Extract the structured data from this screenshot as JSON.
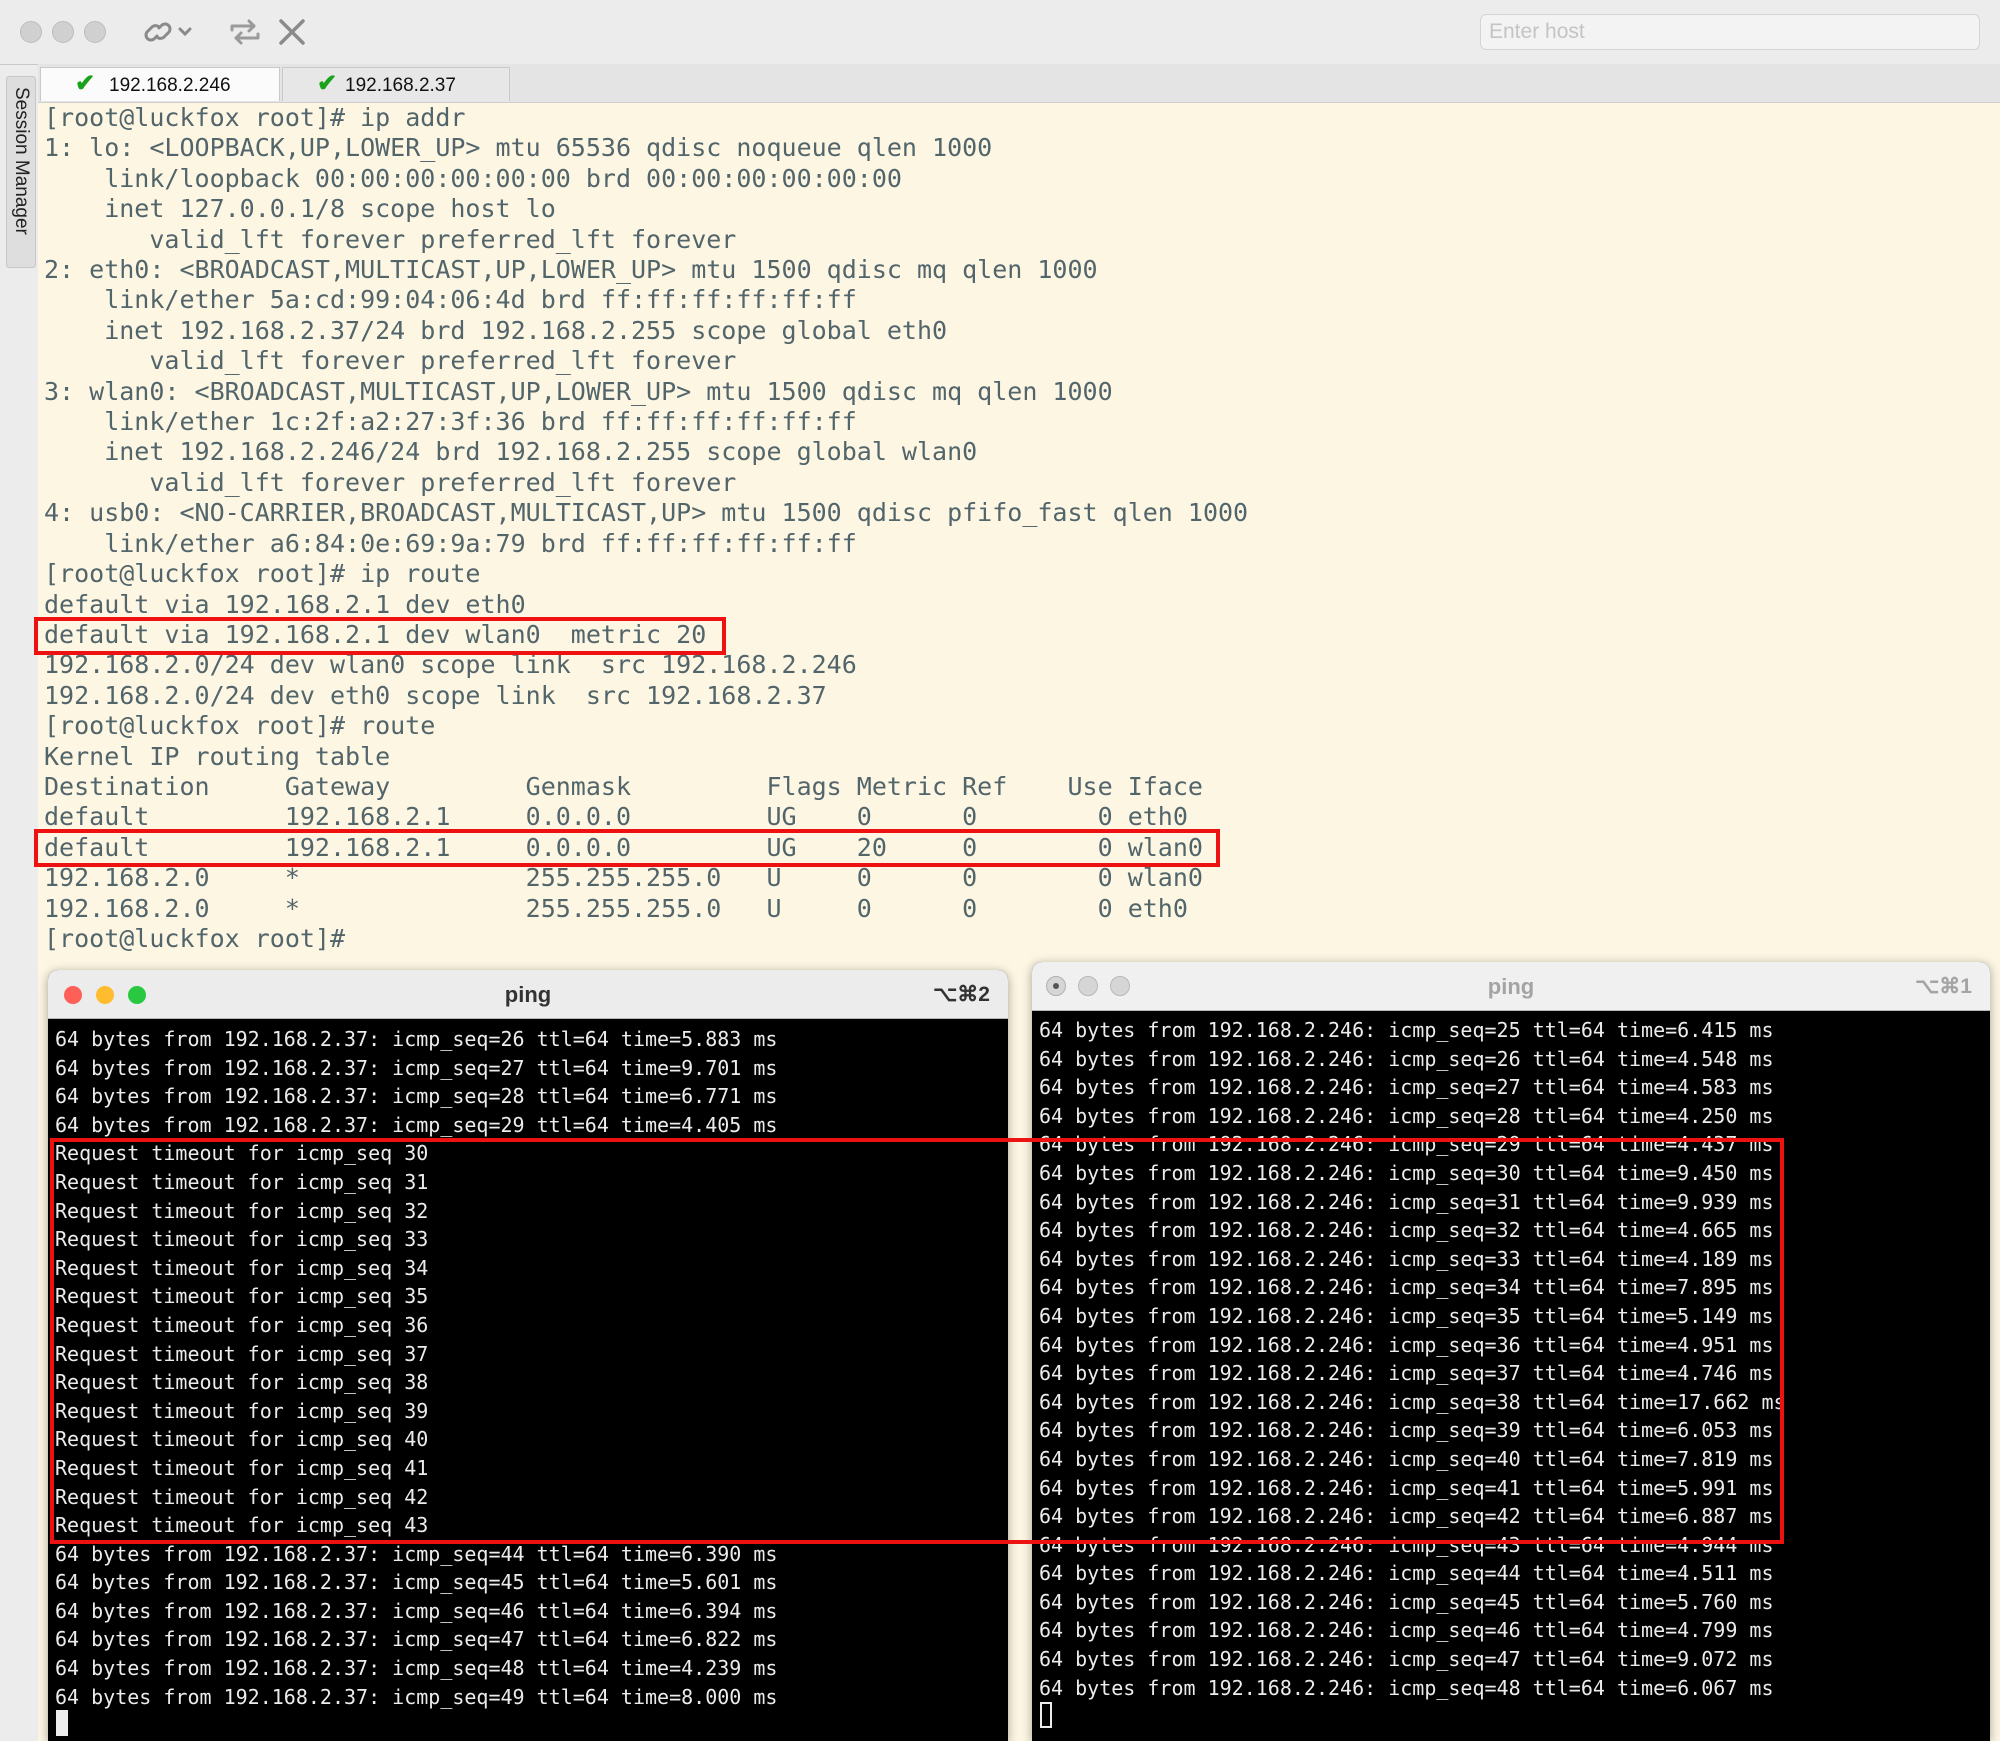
{
  "toolbar": {
    "link_icon": "link-icon",
    "refresh_icon": "repeat-icon",
    "close_icon": "close-icon",
    "host_placeholder": "Enter host"
  },
  "session_manager_label": "Session Manager",
  "tabs": [
    {
      "label": "192.168.2.246",
      "status_icon": "check-icon"
    },
    {
      "label": "192.168.2.37",
      "status_icon": "check-icon"
    }
  ],
  "main_terminal": {
    "lines": [
      "[root@luckfox root]# ip addr",
      "1: lo: <LOOPBACK,UP,LOWER_UP> mtu 65536 qdisc noqueue qlen 1000",
      "    link/loopback 00:00:00:00:00:00 brd 00:00:00:00:00:00",
      "    inet 127.0.0.1/8 scope host lo",
      "       valid_lft forever preferred_lft forever",
      "2: eth0: <BROADCAST,MULTICAST,UP,LOWER_UP> mtu 1500 qdisc mq qlen 1000",
      "    link/ether 5a:cd:99:04:06:4d brd ff:ff:ff:ff:ff:ff",
      "    inet 192.168.2.37/24 brd 192.168.2.255 scope global eth0",
      "       valid_lft forever preferred_lft forever",
      "3: wlan0: <BROADCAST,MULTICAST,UP,LOWER_UP> mtu 1500 qdisc mq qlen 1000",
      "    link/ether 1c:2f:a2:27:3f:36 brd ff:ff:ff:ff:ff:ff",
      "    inet 192.168.2.246/24 brd 192.168.2.255 scope global wlan0",
      "       valid_lft forever preferred_lft forever",
      "4: usb0: <NO-CARRIER,BROADCAST,MULTICAST,UP> mtu 1500 qdisc pfifo_fast qlen 1000",
      "    link/ether a6:84:0e:69:9a:79 brd ff:ff:ff:ff:ff:ff",
      "[root@luckfox root]# ip route",
      "default via 192.168.2.1 dev eth0",
      "default via 192.168.2.1 dev wlan0  metric 20",
      "192.168.2.0/24 dev wlan0 scope link  src 192.168.2.246",
      "192.168.2.0/24 dev eth0 scope link  src 192.168.2.37",
      "[root@luckfox root]# route",
      "Kernel IP routing table",
      "Destination     Gateway         Genmask         Flags Metric Ref    Use Iface",
      "default         192.168.2.1     0.0.0.0         UG    0      0        0 eth0",
      "default         192.168.2.1     0.0.0.0         UG    20     0        0 wlan0",
      "192.168.2.0     *               255.255.255.0   U     0      0        0 wlan0",
      "192.168.2.0     *               255.255.255.0   U     0      0        0 eth0",
      "[root@luckfox root]#"
    ],
    "highlight_color": "#ee1111"
  },
  "ping_left": {
    "title": "ping",
    "shortcut": "⌥⌘2",
    "lines": [
      "64 bytes from 192.168.2.37: icmp_seq=26 ttl=64 time=5.883 ms",
      "64 bytes from 192.168.2.37: icmp_seq=27 ttl=64 time=9.701 ms",
      "64 bytes from 192.168.2.37: icmp_seq=28 ttl=64 time=6.771 ms",
      "64 bytes from 192.168.2.37: icmp_seq=29 ttl=64 time=4.405 ms",
      "Request timeout for icmp_seq 30",
      "Request timeout for icmp_seq 31",
      "Request timeout for icmp_seq 32",
      "Request timeout for icmp_seq 33",
      "Request timeout for icmp_seq 34",
      "Request timeout for icmp_seq 35",
      "Request timeout for icmp_seq 36",
      "Request timeout for icmp_seq 37",
      "Request timeout for icmp_seq 38",
      "Request timeout for icmp_seq 39",
      "Request timeout for icmp_seq 40",
      "Request timeout for icmp_seq 41",
      "Request timeout for icmp_seq 42",
      "Request timeout for icmp_seq 43",
      "64 bytes from 192.168.2.37: icmp_seq=44 ttl=64 time=6.390 ms",
      "64 bytes from 192.168.2.37: icmp_seq=45 ttl=64 time=5.601 ms",
      "64 bytes from 192.168.2.37: icmp_seq=46 ttl=64 time=6.394 ms",
      "64 bytes from 192.168.2.37: icmp_seq=47 ttl=64 time=6.822 ms",
      "64 bytes from 192.168.2.37: icmp_seq=48 ttl=64 time=4.239 ms",
      "64 bytes from 192.168.2.37: icmp_seq=49 ttl=64 time=8.000 ms"
    ]
  },
  "ping_right": {
    "title": "ping",
    "shortcut": "⌥⌘1",
    "lines": [
      "64 bytes from 192.168.2.246: icmp_seq=25 ttl=64 time=6.415 ms",
      "64 bytes from 192.168.2.246: icmp_seq=26 ttl=64 time=4.548 ms",
      "64 bytes from 192.168.2.246: icmp_seq=27 ttl=64 time=4.583 ms",
      "64 bytes from 192.168.2.246: icmp_seq=28 ttl=64 time=4.250 ms",
      "64 bytes from 192.168.2.246: icmp_seq=29 ttl=64 time=4.437 ms",
      "64 bytes from 192.168.2.246: icmp_seq=30 ttl=64 time=9.450 ms",
      "64 bytes from 192.168.2.246: icmp_seq=31 ttl=64 time=9.939 ms",
      "64 bytes from 192.168.2.246: icmp_seq=32 ttl=64 time=4.665 ms",
      "64 bytes from 192.168.2.246: icmp_seq=33 ttl=64 time=4.189 ms",
      "64 bytes from 192.168.2.246: icmp_seq=34 ttl=64 time=7.895 ms",
      "64 bytes from 192.168.2.246: icmp_seq=35 ttl=64 time=5.149 ms",
      "64 bytes from 192.168.2.246: icmp_seq=36 ttl=64 time=4.951 ms",
      "64 bytes from 192.168.2.246: icmp_seq=37 ttl=64 time=4.746 ms",
      "64 bytes from 192.168.2.246: icmp_seq=38 ttl=64 time=17.662 ms",
      "64 bytes from 192.168.2.246: icmp_seq=39 ttl=64 time=6.053 ms",
      "64 bytes from 192.168.2.246: icmp_seq=40 ttl=64 time=7.819 ms",
      "64 bytes from 192.168.2.246: icmp_seq=41 ttl=64 time=5.991 ms",
      "64 bytes from 192.168.2.246: icmp_seq=42 ttl=64 time=6.887 ms",
      "64 bytes from 192.168.2.246: icmp_seq=43 ttl=64 time=4.944 ms",
      "64 bytes from 192.168.2.246: icmp_seq=44 ttl=64 time=4.511 ms",
      "64 bytes from 192.168.2.246: icmp_seq=45 ttl=64 time=5.760 ms",
      "64 bytes from 192.168.2.246: icmp_seq=46 ttl=64 time=4.799 ms",
      "64 bytes from 192.168.2.246: icmp_seq=47 ttl=64 time=9.072 ms",
      "64 bytes from 192.168.2.246: icmp_seq=48 ttl=64 time=6.067 ms"
    ]
  },
  "colors": {
    "main_bg": "#fdf6e3",
    "main_fg": "#52656b",
    "ping_bg": "#000000",
    "ping_fg": "#ececec",
    "tab_check": "#1aa31a",
    "highlight": "#ee1111",
    "traffic_red": "#fe5f57",
    "traffic_yellow": "#febc2e",
    "traffic_green": "#28c840"
  }
}
